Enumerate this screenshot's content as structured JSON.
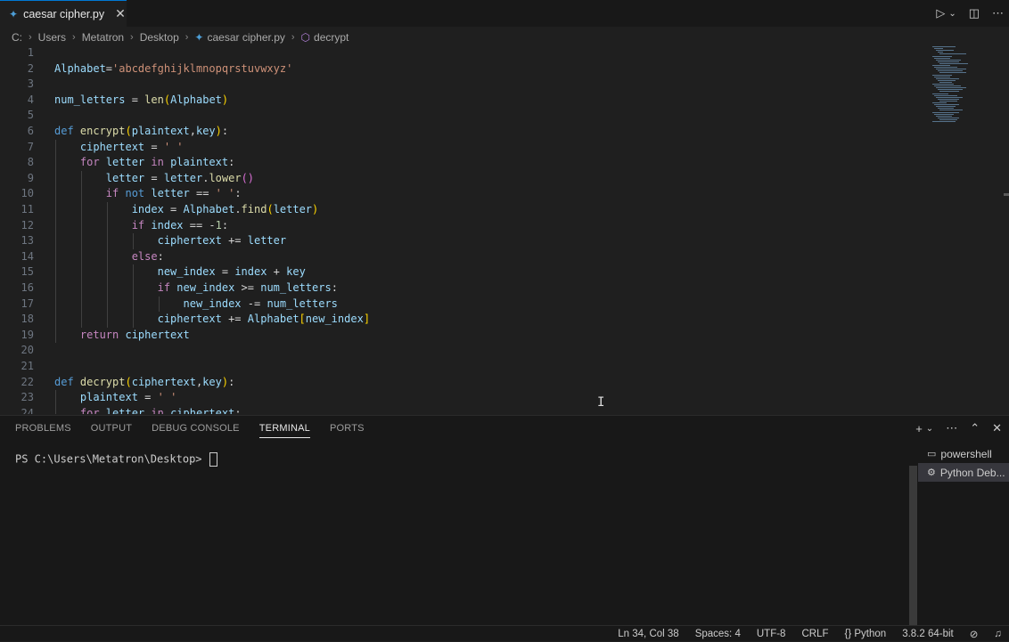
{
  "tab": {
    "title": "caesar cipher.py",
    "close": "✕"
  },
  "breadcrumb": [
    "C:",
    "Users",
    "Metatron",
    "Desktop",
    "caesar cipher.py",
    "decrypt"
  ],
  "editor": {
    "lines": [
      {
        "n": "1",
        "t": []
      },
      {
        "n": "2",
        "t": [
          [
            "vr",
            "Alphabet"
          ],
          [
            "op",
            "="
          ],
          [
            "str",
            "'abcdefghijklmnopqrstuvwxyz'"
          ]
        ]
      },
      {
        "n": "3",
        "t": []
      },
      {
        "n": "4",
        "t": [
          [
            "vr",
            "num_letters"
          ],
          [
            "op",
            " = "
          ],
          [
            "fn",
            "len"
          ],
          [
            "br1",
            "("
          ],
          [
            "vr",
            "Alphabet"
          ],
          [
            "br1",
            ")"
          ]
        ]
      },
      {
        "n": "5",
        "t": []
      },
      {
        "n": "6",
        "t": [
          [
            "kw",
            "def "
          ],
          [
            "fn",
            "encrypt"
          ],
          [
            "br1",
            "("
          ],
          [
            "vr",
            "plaintext"
          ],
          [
            "op",
            ","
          ],
          [
            "vr",
            "key"
          ],
          [
            "br1",
            ")"
          ],
          [
            "op",
            ":"
          ]
        ]
      },
      {
        "n": "7",
        "t": [
          [
            "op",
            "    "
          ],
          [
            "vr",
            "ciphertext"
          ],
          [
            "op",
            " = "
          ],
          [
            "str",
            "' '"
          ]
        ]
      },
      {
        "n": "8",
        "t": [
          [
            "op",
            "    "
          ],
          [
            "ctl",
            "for "
          ],
          [
            "vr",
            "letter"
          ],
          [
            "ctl",
            " in "
          ],
          [
            "vr",
            "plaintext"
          ],
          [
            "op",
            ":"
          ]
        ]
      },
      {
        "n": "9",
        "t": [
          [
            "op",
            "        "
          ],
          [
            "vr",
            "letter"
          ],
          [
            "op",
            " = "
          ],
          [
            "vr",
            "letter"
          ],
          [
            "op",
            "."
          ],
          [
            "fn",
            "lower"
          ],
          [
            "br2",
            "()"
          ]
        ]
      },
      {
        "n": "10",
        "t": [
          [
            "op",
            "        "
          ],
          [
            "ctl",
            "if "
          ],
          [
            "kw",
            "not "
          ],
          [
            "vr",
            "letter"
          ],
          [
            "op",
            " == "
          ],
          [
            "str",
            "' '"
          ],
          [
            "op",
            ":"
          ]
        ]
      },
      {
        "n": "11",
        "t": [
          [
            "op",
            "            "
          ],
          [
            "vr",
            "index"
          ],
          [
            "op",
            " = "
          ],
          [
            "vr",
            "Alphabet"
          ],
          [
            "op",
            "."
          ],
          [
            "fn",
            "find"
          ],
          [
            "br1",
            "("
          ],
          [
            "vr",
            "letter"
          ],
          [
            "br1",
            ")"
          ]
        ]
      },
      {
        "n": "12",
        "t": [
          [
            "op",
            "            "
          ],
          [
            "ctl",
            "if "
          ],
          [
            "vr",
            "index"
          ],
          [
            "op",
            " == -"
          ],
          [
            "num",
            "1"
          ],
          [
            "op",
            ":"
          ]
        ]
      },
      {
        "n": "13",
        "t": [
          [
            "op",
            "                "
          ],
          [
            "vr",
            "ciphertext"
          ],
          [
            "op",
            " += "
          ],
          [
            "vr",
            "letter"
          ]
        ]
      },
      {
        "n": "14",
        "t": [
          [
            "op",
            "            "
          ],
          [
            "ctl",
            "else"
          ],
          [
            "op",
            ":"
          ]
        ]
      },
      {
        "n": "15",
        "t": [
          [
            "op",
            "                "
          ],
          [
            "vr",
            "new_index"
          ],
          [
            "op",
            " = "
          ],
          [
            "vr",
            "index"
          ],
          [
            "op",
            " + "
          ],
          [
            "vr",
            "key"
          ]
        ]
      },
      {
        "n": "16",
        "t": [
          [
            "op",
            "                "
          ],
          [
            "ctl",
            "if "
          ],
          [
            "vr",
            "new_index"
          ],
          [
            "op",
            " >= "
          ],
          [
            "vr",
            "num_letters"
          ],
          [
            "op",
            ":"
          ]
        ]
      },
      {
        "n": "17",
        "t": [
          [
            "op",
            "                    "
          ],
          [
            "vr",
            "new_index"
          ],
          [
            "op",
            " -= "
          ],
          [
            "vr",
            "num_letters"
          ]
        ]
      },
      {
        "n": "18",
        "t": [
          [
            "op",
            "                "
          ],
          [
            "vr",
            "ciphertext"
          ],
          [
            "op",
            " += "
          ],
          [
            "vr",
            "Alphabet"
          ],
          [
            "br1",
            "["
          ],
          [
            "vr",
            "new_index"
          ],
          [
            "br1",
            "]"
          ]
        ]
      },
      {
        "n": "19",
        "t": [
          [
            "op",
            "    "
          ],
          [
            "ctl",
            "return "
          ],
          [
            "vr",
            "ciphertext"
          ]
        ]
      },
      {
        "n": "20",
        "t": []
      },
      {
        "n": "21",
        "t": []
      },
      {
        "n": "22",
        "t": [
          [
            "kw",
            "def "
          ],
          [
            "fn",
            "decrypt"
          ],
          [
            "br1",
            "("
          ],
          [
            "vr",
            "ciphertext"
          ],
          [
            "op",
            ","
          ],
          [
            "vr",
            "key"
          ],
          [
            "br1",
            ")"
          ],
          [
            "op",
            ":"
          ]
        ]
      },
      {
        "n": "23",
        "t": [
          [
            "op",
            "    "
          ],
          [
            "vr",
            "plaintext"
          ],
          [
            "op",
            " = "
          ],
          [
            "str",
            "' '"
          ]
        ]
      },
      {
        "n": "24",
        "t": [
          [
            "op",
            "    "
          ],
          [
            "ctl",
            "for "
          ],
          [
            "vr",
            "letter"
          ],
          [
            "ctl",
            " in "
          ],
          [
            "vr",
            "ciphertext"
          ],
          [
            "op",
            ":"
          ]
        ]
      }
    ]
  },
  "panel": {
    "tabs": [
      "PROBLEMS",
      "OUTPUT",
      "DEBUG CONSOLE",
      "TERMINAL",
      "PORTS"
    ],
    "active_tab": "TERMINAL",
    "prompt": "PS C:\\Users\\Metatron\\Desktop> ",
    "terminals": [
      {
        "label": "powershell",
        "icon": "terminal-icon"
      },
      {
        "label": "Python Deb...",
        "icon": "debug-gear-icon"
      }
    ]
  },
  "status": {
    "position": "Ln 34, Col 38",
    "spaces": "Spaces: 4",
    "encoding": "UTF-8",
    "eol": "CRLF",
    "language": "Python",
    "interpreter": "3.8.2 64-bit"
  },
  "colors": {
    "accent": "#0078d4",
    "background": "#1f1f1f",
    "chrome": "#181818"
  }
}
